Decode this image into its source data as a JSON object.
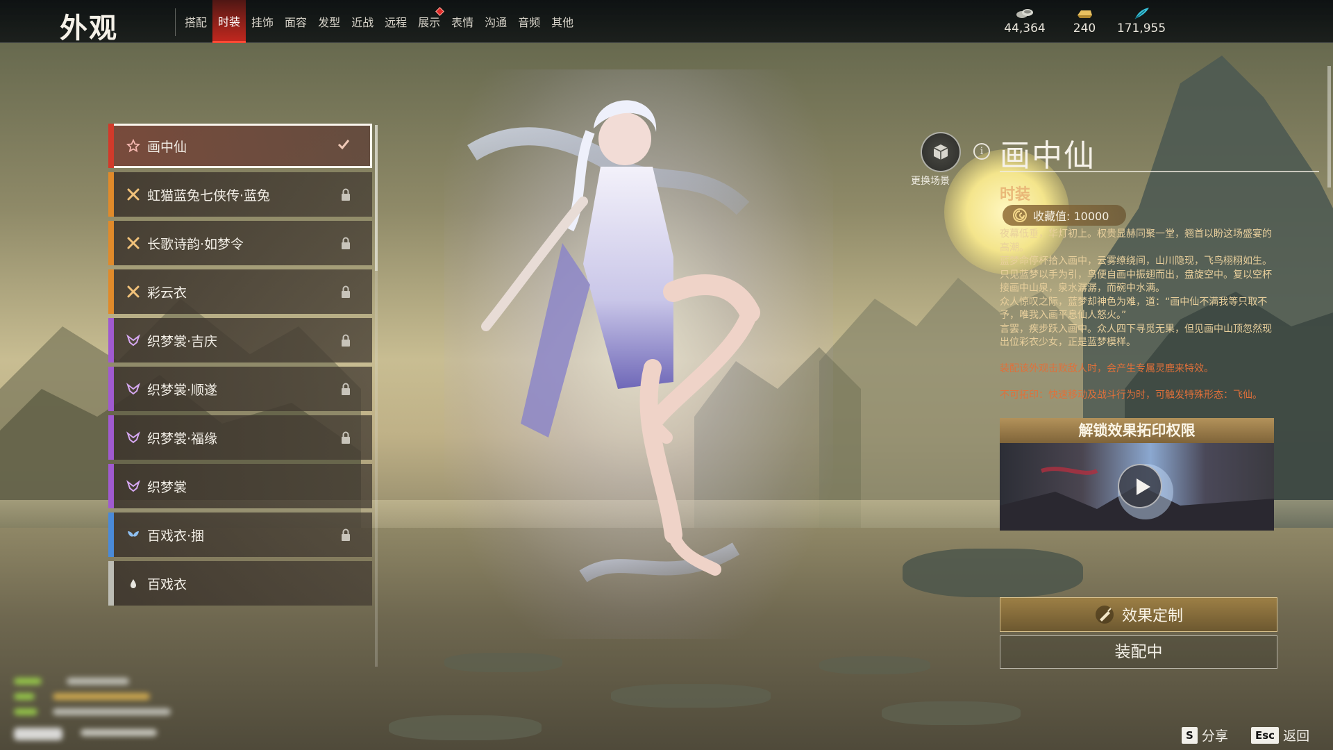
{
  "header": {
    "title": "外观",
    "tabs": [
      {
        "label": "搭配"
      },
      {
        "label": "时装"
      },
      {
        "label": "挂饰"
      },
      {
        "label": "面容"
      },
      {
        "label": "发型"
      },
      {
        "label": "近战"
      },
      {
        "label": "远程"
      },
      {
        "label": "展示"
      },
      {
        "label": "表情"
      },
      {
        "label": "沟通"
      },
      {
        "label": "音频"
      },
      {
        "label": "其他"
      }
    ],
    "active_tab": "时装",
    "currencies": [
      {
        "icon": "coin-stack-icon",
        "value": "44,364"
      },
      {
        "icon": "gold-ingot-icon",
        "value": "240"
      },
      {
        "icon": "feather-quill-icon",
        "value": "171,955"
      }
    ]
  },
  "list": {
    "items": [
      {
        "name": "画中仙",
        "rarity_color": "#d23a2a",
        "icon": "flower-icon",
        "state": "equipped"
      },
      {
        "name": "虹猫蓝兔七侠传·蓝兔",
        "rarity_color": "#e08a2a",
        "icon": "knot-icon",
        "state": "locked"
      },
      {
        "name": "长歌诗韵·如梦令",
        "rarity_color": "#e08a2a",
        "icon": "knot-icon",
        "state": "locked"
      },
      {
        "name": "彩云衣",
        "rarity_color": "#e08a2a",
        "icon": "knot-icon",
        "state": "locked"
      },
      {
        "name": "织梦裳·吉庆",
        "rarity_color": "#a05ad0",
        "icon": "butterfly-icon",
        "state": "locked"
      },
      {
        "name": "织梦裳·顺遂",
        "rarity_color": "#a05ad0",
        "icon": "butterfly-icon",
        "state": "locked"
      },
      {
        "name": "织梦裳·福缘",
        "rarity_color": "#a05ad0",
        "icon": "butterfly-icon",
        "state": "locked"
      },
      {
        "name": "织梦裳",
        "rarity_color": "#a05ad0",
        "icon": "butterfly-icon",
        "state": "none"
      },
      {
        "name": "百戏衣·捆",
        "rarity_color": "#4a8ad8",
        "icon": "moth-icon",
        "state": "locked"
      },
      {
        "name": "百戏衣",
        "rarity_color": "#bdbdb5",
        "icon": "drop-icon",
        "state": "none"
      }
    ]
  },
  "detail": {
    "scene_button_label": "更换场景",
    "info_symbol": "i",
    "title": "画中仙",
    "category": "时装",
    "collection_label": "收藏值: 10000",
    "description": [
      "夜幕低垂，华灯初上。权贵显赫同聚一堂，翘首以盼这场盛宴的高潮。",
      "蓝梦命停杯拾入画中，云雾缭绕间，山川隐现，飞鸟栩栩如生。只见蓝梦以手为引，鸟便自画中振翅而出，盘旋空中。复以空杯接画中山泉，泉水潺潺，而碗中水满。",
      "众人惊叹之际，蓝梦却神色为难，道：“画中仙不满我等只取不予，唯我入画平息仙人怒火。”",
      "言罢，疾步跃入画中。众人四下寻觅无果，但见画中山顶忽然现出位彩衣少女，正是蓝梦模样。"
    ],
    "effect_text": "装配该外观击败敌人时，会产生专属灵鹿来特效。",
    "imprint_text": "不可拓印：快速移动及战斗行为时，可触发特殊形态：飞仙。",
    "unlock_header": "解锁效果拓印权限",
    "customize_label": "效果定制",
    "equip_label": "装配中"
  },
  "footer": {
    "hints": [
      {
        "key": "S",
        "label": "分享"
      },
      {
        "key": "Esc",
        "label": "返回"
      }
    ]
  },
  "colors": {
    "tab_active": "#e8342a",
    "accent_gold": "#e9b878",
    "effect_text": "#e0703a",
    "selected_outline": "#fbf6ee"
  }
}
